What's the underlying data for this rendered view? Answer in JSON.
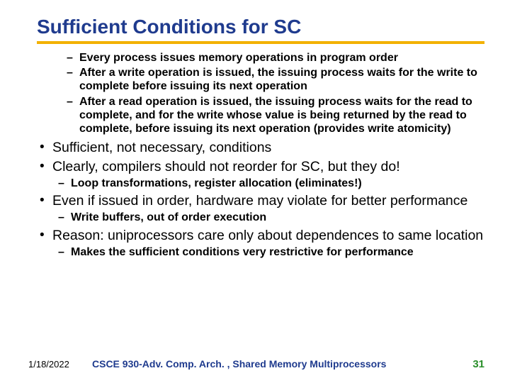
{
  "title": "Sufficient Conditions for SC",
  "leading_dashes": [
    "Every process issues memory operations in program order",
    "After a write operation is issued, the issuing process waits for the write to complete before issuing its next operation",
    "After a read operation is issued, the issuing process waits for the read to complete, and for the write whose value is being returned by the read to complete, before issuing its next operation (provides write atomicity)"
  ],
  "bullets": [
    {
      "text": "Sufficient, not necessary, conditions",
      "sub": []
    },
    {
      "text": "Clearly, compilers should not reorder for SC, but they do!",
      "sub": [
        "Loop transformations, register allocation (eliminates!)"
      ]
    },
    {
      "text": "Even if issued in order, hardware may violate for better performance",
      "sub": [
        "Write buffers, out of order execution"
      ]
    },
    {
      "text": "Reason: uniprocessors care only about dependences to same location",
      "sub": [
        "Makes the sufficient conditions very restrictive for performance"
      ]
    }
  ],
  "footer": {
    "date": "1/18/2022",
    "course": "CSCE 930-Adv. Comp. Arch. , Shared Memory Multiprocessors",
    "page": "31"
  }
}
